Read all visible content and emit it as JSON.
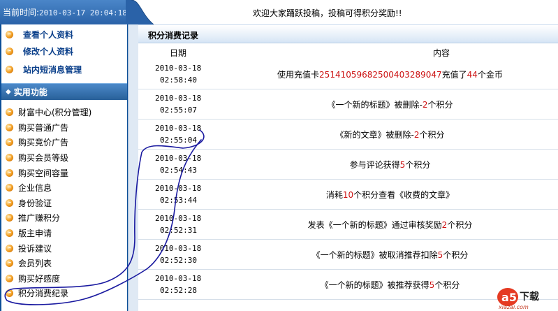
{
  "header": {
    "time_label": "当前时间:",
    "time_value": "2010-03-17 20:04:18",
    "notice": "欢迎大家踊跃投稿，投稿可得积分奖励!!"
  },
  "sidebar": {
    "top_items": [
      {
        "label": "查看个人资料"
      },
      {
        "label": "修改个人资料"
      },
      {
        "label": "站内短消息管理"
      }
    ],
    "section_title": "实用功能",
    "items": [
      {
        "label": "财富中心(积分管理)"
      },
      {
        "label": "购买普通广告"
      },
      {
        "label": "购买竞价广告"
      },
      {
        "label": "购买会员等级"
      },
      {
        "label": "购买空间容量"
      },
      {
        "label": "企业信息"
      },
      {
        "label": "身份验证"
      },
      {
        "label": "推广赚积分"
      },
      {
        "label": "版主申请"
      },
      {
        "label": "投诉建议"
      },
      {
        "label": "会员列表"
      },
      {
        "label": "购买好感度"
      },
      {
        "label": "积分消费纪录"
      }
    ]
  },
  "main": {
    "title": "积分消费记录",
    "columns": {
      "date": "日期",
      "content": "内容"
    },
    "rows": [
      {
        "date": "2010-03-18",
        "time": "02:58:40",
        "pre": "使用充值卡",
        "v1": "25141059682500403289047",
        "mid": "充值了",
        "v2": "44",
        "post": "个金币"
      },
      {
        "date": "2010-03-18",
        "time": "02:55:07",
        "pre": "《一个新的标题》被删除-",
        "v1": "2",
        "mid": "个积分",
        "v2": "",
        "post": ""
      },
      {
        "date": "2010-03-18",
        "time": "02:55:04",
        "pre": "《新的文章》被删除-",
        "v1": "2",
        "mid": "个积分",
        "v2": "",
        "post": ""
      },
      {
        "date": "2010-03-18",
        "time": "02:54:43",
        "pre": "参与评论获得",
        "v1": "5",
        "mid": "个积分",
        "v2": "",
        "post": ""
      },
      {
        "date": "2010-03-18",
        "time": "02:53:44",
        "pre": "消耗",
        "v1": "10",
        "mid": "个积分查看《收费的文章》",
        "v2": "",
        "post": ""
      },
      {
        "date": "2010-03-18",
        "time": "02:52:31",
        "pre": "发表《一个新的标题》通过审核奖励",
        "v1": "2",
        "mid": "个积分",
        "v2": "",
        "post": ""
      },
      {
        "date": "2010-03-18",
        "time": "02:52:30",
        "pre": "《一个新的标题》被取消推荐扣除",
        "v1": "5",
        "mid": "个积分",
        "v2": "",
        "post": ""
      },
      {
        "date": "2010-03-18",
        "time": "02:52:28",
        "pre": "《一个新的标题》被推荐获得",
        "v1": "5",
        "mid": "个积分",
        "v2": "",
        "post": ""
      }
    ]
  },
  "watermark": {
    "logo": "a5",
    "cn": "下载",
    "en": "xiazai.com"
  },
  "colors": {
    "sidebar_blue": "#0c4f97",
    "link_blue": "#0a3f8a",
    "highlight_red": "#cc1111",
    "ink": "#1a1aa0"
  }
}
